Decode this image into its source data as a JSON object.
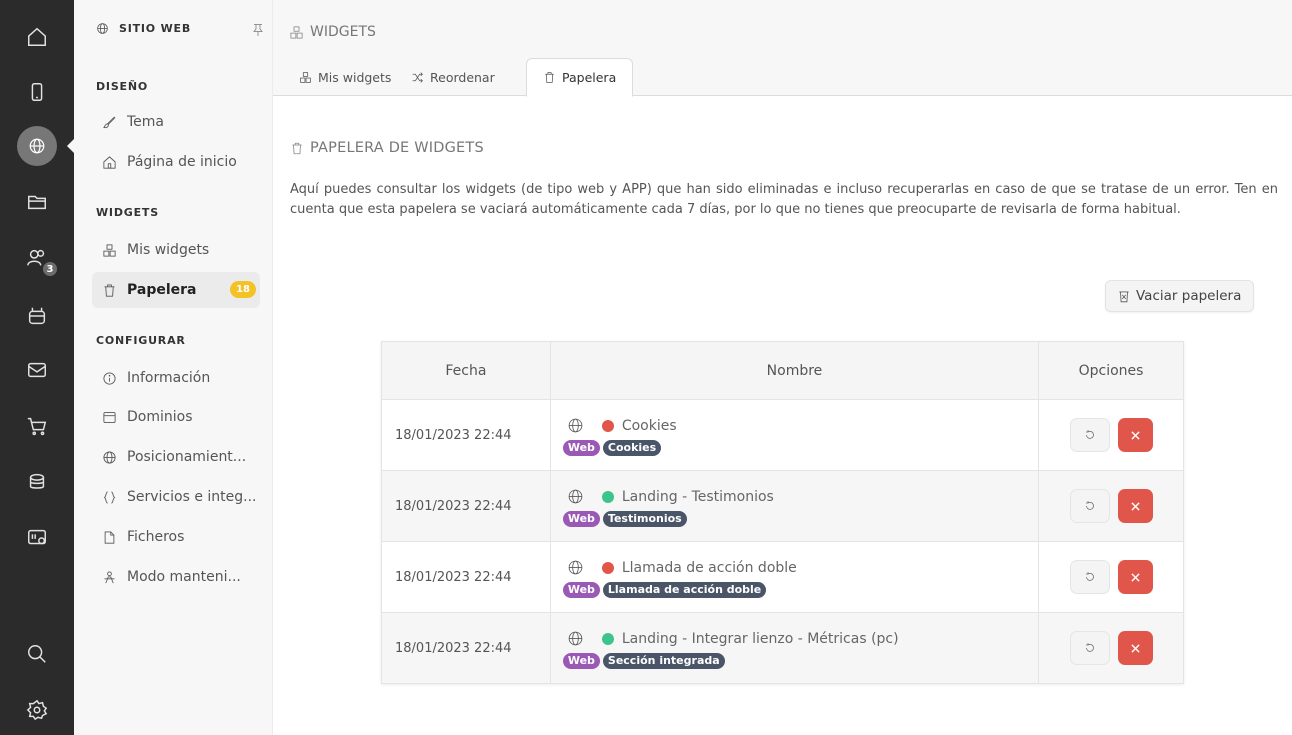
{
  "colors": {
    "rail_bg": "#2b2b2b",
    "tag_web": "#9b59b6",
    "tag_dark": "#4a5568",
    "delete_red": "#e0564b",
    "count_yellow": "#f5c225",
    "dot_red": "#e0564b",
    "dot_green": "#3cc48c"
  },
  "rail": {
    "badge": "3"
  },
  "sidebar": {
    "header": "SITIO WEB",
    "sections": {
      "diseno": "DISEÑO",
      "widgets": "WIDGETS",
      "configurar": "CONFIGURAR"
    },
    "items": {
      "tema": "Tema",
      "pagina_inicio": "Página de inicio",
      "mis_widgets": "Mis widgets",
      "papelera": "Papelera",
      "papelera_count": "18",
      "informacion": "Información",
      "dominios": "Dominios",
      "posicionamiento": "Posicionamient...",
      "servicios": "Servicios e integ...",
      "ficheros": "Ficheros",
      "mantenimiento": "Modo manteni..."
    }
  },
  "breadcrumb": "WIDGETS",
  "tabs": {
    "mis_widgets": "Mis widgets",
    "reordenar": "Reordenar",
    "papelera": "Papelera"
  },
  "heading": "PAPELERA DE WIDGETS",
  "description": "Aquí puedes consultar los widgets (de tipo web y APP) que han sido eliminadas e incluso recuperarlas en caso de que se tratase de un error. Ten en cuenta que esta papelera se vaciará automáticamente cada 7 días, por lo que no tienes que preocuparte de revisarla de forma habitual.",
  "empty_button": "Vaciar papelera",
  "table": {
    "headers": {
      "fecha": "Fecha",
      "nombre": "Nombre",
      "opciones": "Opciones"
    },
    "rows": [
      {
        "fecha": "18/01/2023 22:44",
        "nombre": "Cookies",
        "status": "red",
        "tag1": "Web",
        "tag2": "Cookies"
      },
      {
        "fecha": "18/01/2023 22:44",
        "nombre": "Landing - Testimonios",
        "status": "green",
        "tag1": "Web",
        "tag2": "Testimonios"
      },
      {
        "fecha": "18/01/2023 22:44",
        "nombre": "Llamada de acción doble",
        "status": "red",
        "tag1": "Web",
        "tag2": "Llamada de acción doble"
      },
      {
        "fecha": "18/01/2023 22:44",
        "nombre": "Landing - Integrar lienzo - Métricas (pc)",
        "status": "green",
        "tag1": "Web",
        "tag2": "Sección integrada"
      }
    ]
  }
}
